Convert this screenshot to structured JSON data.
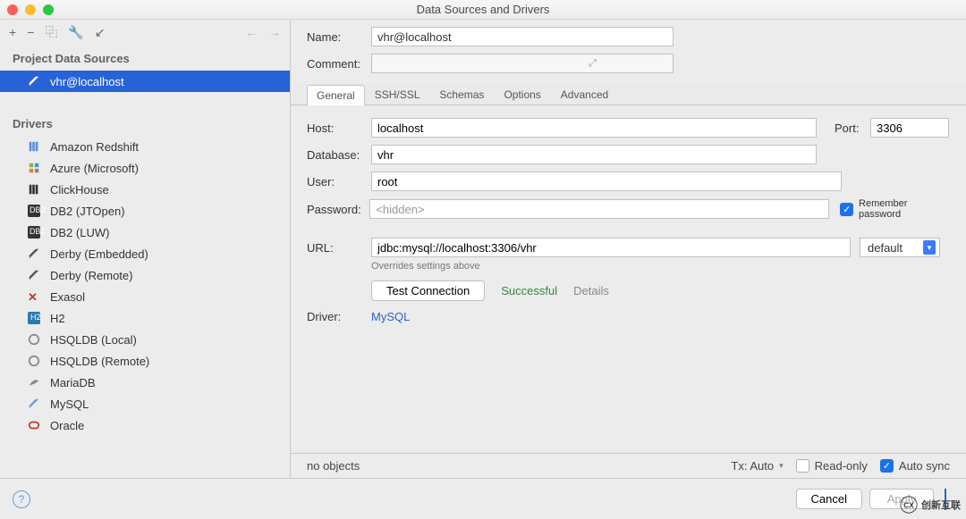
{
  "window": {
    "title": "Data Sources and Drivers"
  },
  "toolbar": {
    "add_icon": "+",
    "remove_icon": "−",
    "copy_icon": "⿻",
    "wrench_icon": "🔧",
    "sort_icon": "↙",
    "back_icon": "←",
    "fwd_icon": "→"
  },
  "sidebar": {
    "ds_header": "Project Data Sources",
    "ds_items": [
      {
        "label": "vhr@localhost",
        "icon": "feather",
        "selected": true
      }
    ],
    "drivers_header": "Drivers",
    "drivers": [
      {
        "label": "Amazon Redshift",
        "icon": "bars-blue"
      },
      {
        "label": "Azure (Microsoft)",
        "icon": "squares"
      },
      {
        "label": "ClickHouse",
        "icon": "bars-dark"
      },
      {
        "label": "DB2 (JTOpen)",
        "icon": "db2"
      },
      {
        "label": "DB2 (LUW)",
        "icon": "db2"
      },
      {
        "label": "Derby (Embedded)",
        "icon": "feather-dark"
      },
      {
        "label": "Derby (Remote)",
        "icon": "feather-dark"
      },
      {
        "label": "Exasol",
        "icon": "x"
      },
      {
        "label": "H2",
        "icon": "h2"
      },
      {
        "label": "HSQLDB (Local)",
        "icon": "hsql"
      },
      {
        "label": "HSQLDB (Remote)",
        "icon": "hsql"
      },
      {
        "label": "MariaDB",
        "icon": "maria"
      },
      {
        "label": "MySQL",
        "icon": "mysql"
      },
      {
        "label": "Oracle",
        "icon": "oracle"
      }
    ]
  },
  "form": {
    "name_label": "Name:",
    "name_value": "vhr@localhost",
    "comment_label": "Comment:",
    "comment_value": ""
  },
  "tabs": [
    "General",
    "SSH/SSL",
    "Schemas",
    "Options",
    "Advanced"
  ],
  "general": {
    "host_label": "Host:",
    "host": "localhost",
    "port_label": "Port:",
    "port": "3306",
    "db_label": "Database:",
    "db": "vhr",
    "user_label": "User:",
    "user": "root",
    "pwd_label": "Password:",
    "pwd": "<hidden>",
    "remember": "Remember password",
    "url_label": "URL:",
    "url": "jdbc:mysql://localhost:3306/vhr",
    "url_mode": "default",
    "url_hint": "Overrides settings above",
    "test_btn": "Test Connection",
    "test_result": "Successful",
    "details": "Details",
    "driver_label": "Driver:",
    "driver": "MySQL"
  },
  "status": {
    "objects": "no objects",
    "tx": "Tx: Auto",
    "readonly": "Read-only",
    "autosync": "Auto sync"
  },
  "footer": {
    "cancel": "Cancel",
    "apply": "Apply"
  },
  "watermark": "创新互联"
}
